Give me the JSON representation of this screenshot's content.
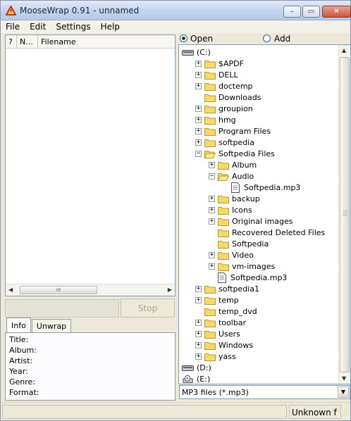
{
  "window": {
    "title": "MooseWrap 0.91 - unnamed",
    "minimize": "–",
    "maximize": "▭",
    "close": "✕"
  },
  "menu": [
    "File",
    "Edit",
    "Settings",
    "Help"
  ],
  "list": {
    "columns": [
      "?",
      "N...",
      "Filename"
    ],
    "scroll_grip": "III",
    "stop_label": "Stop"
  },
  "info": {
    "tabs": [
      "Info",
      "Unwrap"
    ],
    "fields": [
      "Title:",
      "Album:",
      "Artist:",
      "Year:",
      "Genre:",
      "Format:"
    ]
  },
  "mode": {
    "open_label": "Open",
    "add_label": "Add",
    "selected": "open"
  },
  "tree": [
    {
      "label": "(C:)",
      "type": "drive",
      "depth": 0,
      "exp": "none"
    },
    {
      "label": "$APDF",
      "type": "folder",
      "depth": 1,
      "exp": "plus"
    },
    {
      "label": "DELL",
      "type": "folder",
      "depth": 1,
      "exp": "plus"
    },
    {
      "label": "doctemp",
      "type": "folder",
      "depth": 1,
      "exp": "plus"
    },
    {
      "label": "Downloads",
      "type": "folder",
      "depth": 1,
      "exp": "none"
    },
    {
      "label": "groupion",
      "type": "folder",
      "depth": 1,
      "exp": "plus"
    },
    {
      "label": "hmg",
      "type": "folder",
      "depth": 1,
      "exp": "plus"
    },
    {
      "label": "Program Files",
      "type": "folder",
      "depth": 1,
      "exp": "plus"
    },
    {
      "label": "softpedia",
      "type": "folder",
      "depth": 1,
      "exp": "plus"
    },
    {
      "label": "Softpedia Files",
      "type": "folder-open",
      "depth": 1,
      "exp": "minus"
    },
    {
      "label": "Album",
      "type": "folder",
      "depth": 2,
      "exp": "plus"
    },
    {
      "label": "Audio",
      "type": "folder-open",
      "depth": 2,
      "exp": "minus"
    },
    {
      "label": "Softpedia.mp3",
      "type": "file",
      "depth": 3,
      "exp": "none"
    },
    {
      "label": "backup",
      "type": "folder",
      "depth": 2,
      "exp": "plus"
    },
    {
      "label": "Icons",
      "type": "folder",
      "depth": 2,
      "exp": "plus"
    },
    {
      "label": "Original images",
      "type": "folder",
      "depth": 2,
      "exp": "plus"
    },
    {
      "label": "Recovered Deleted Files",
      "type": "folder",
      "depth": 2,
      "exp": "none"
    },
    {
      "label": "Softpedia",
      "type": "folder",
      "depth": 2,
      "exp": "none"
    },
    {
      "label": "Video",
      "type": "folder",
      "depth": 2,
      "exp": "plus"
    },
    {
      "label": "vm-images",
      "type": "folder",
      "depth": 2,
      "exp": "plus"
    },
    {
      "label": "Softpedia.mp3",
      "type": "file",
      "depth": 2,
      "exp": "none"
    },
    {
      "label": "softpedia1",
      "type": "folder",
      "depth": 1,
      "exp": "plus"
    },
    {
      "label": "temp",
      "type": "folder",
      "depth": 1,
      "exp": "plus"
    },
    {
      "label": "temp_dvd",
      "type": "folder",
      "depth": 1,
      "exp": "none"
    },
    {
      "label": "toolbar",
      "type": "folder",
      "depth": 1,
      "exp": "plus"
    },
    {
      "label": "Users",
      "type": "folder",
      "depth": 1,
      "exp": "plus"
    },
    {
      "label": "Windows",
      "type": "folder",
      "depth": 1,
      "exp": "plus"
    },
    {
      "label": "yass",
      "type": "folder",
      "depth": 1,
      "exp": "plus"
    },
    {
      "label": "(D:)",
      "type": "drive",
      "depth": 0,
      "exp": "none"
    },
    {
      "label": "(E:)",
      "type": "cdrom",
      "depth": 0,
      "exp": "none"
    }
  ],
  "filter": {
    "value": "MP3 files (*.mp3)"
  },
  "status": {
    "right": "Unknown f"
  },
  "colors": {
    "folder": "#f6d86b",
    "folder_edge": "#b89a2a",
    "selection_radio": "#1e4a1e"
  }
}
